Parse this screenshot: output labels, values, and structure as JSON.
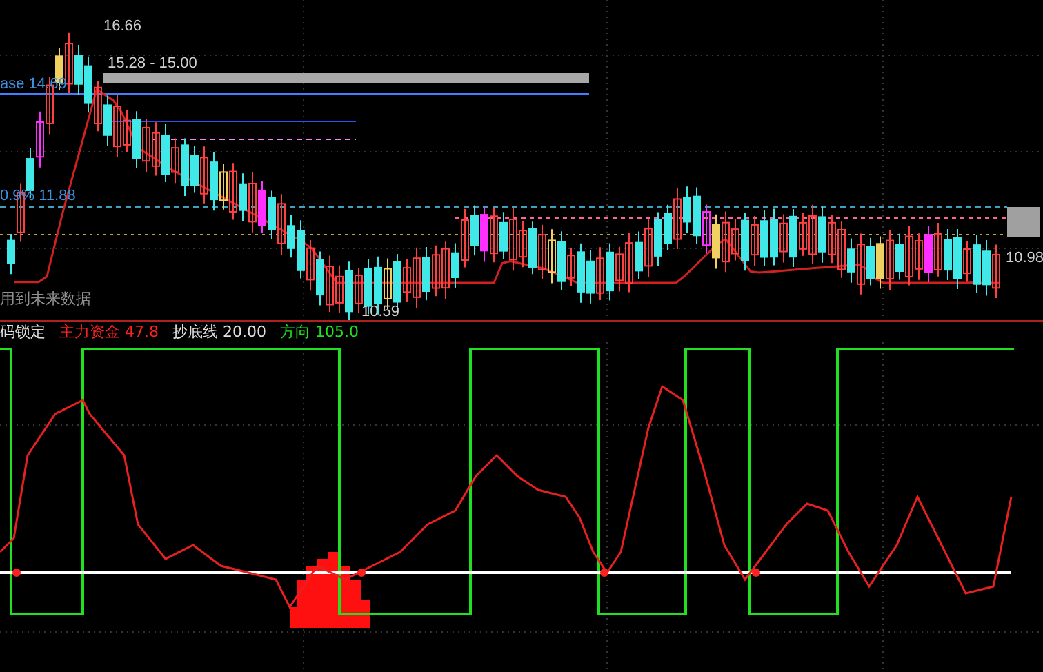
{
  "main_chart": {
    "high_label": "16.66",
    "range_label": "15.28 - 15.00",
    "base_label": "ase 14.69",
    "percent_label": "0.9% 11.88",
    "low_label": "10.59",
    "last_label": "10.98",
    "note": "用到未来数据"
  },
  "indicator": {
    "legend": [
      {
        "label": "码锁定",
        "color": "#e0e0e0"
      },
      {
        "label": "主力资金",
        "value": "47.8",
        "color": "#ff2020"
      },
      {
        "label": "抄底线",
        "value": "20.00",
        "color": "#e0e0e0"
      },
      {
        "label": "方向",
        "value": "105.0",
        "color": "#20e020"
      }
    ]
  }
}
